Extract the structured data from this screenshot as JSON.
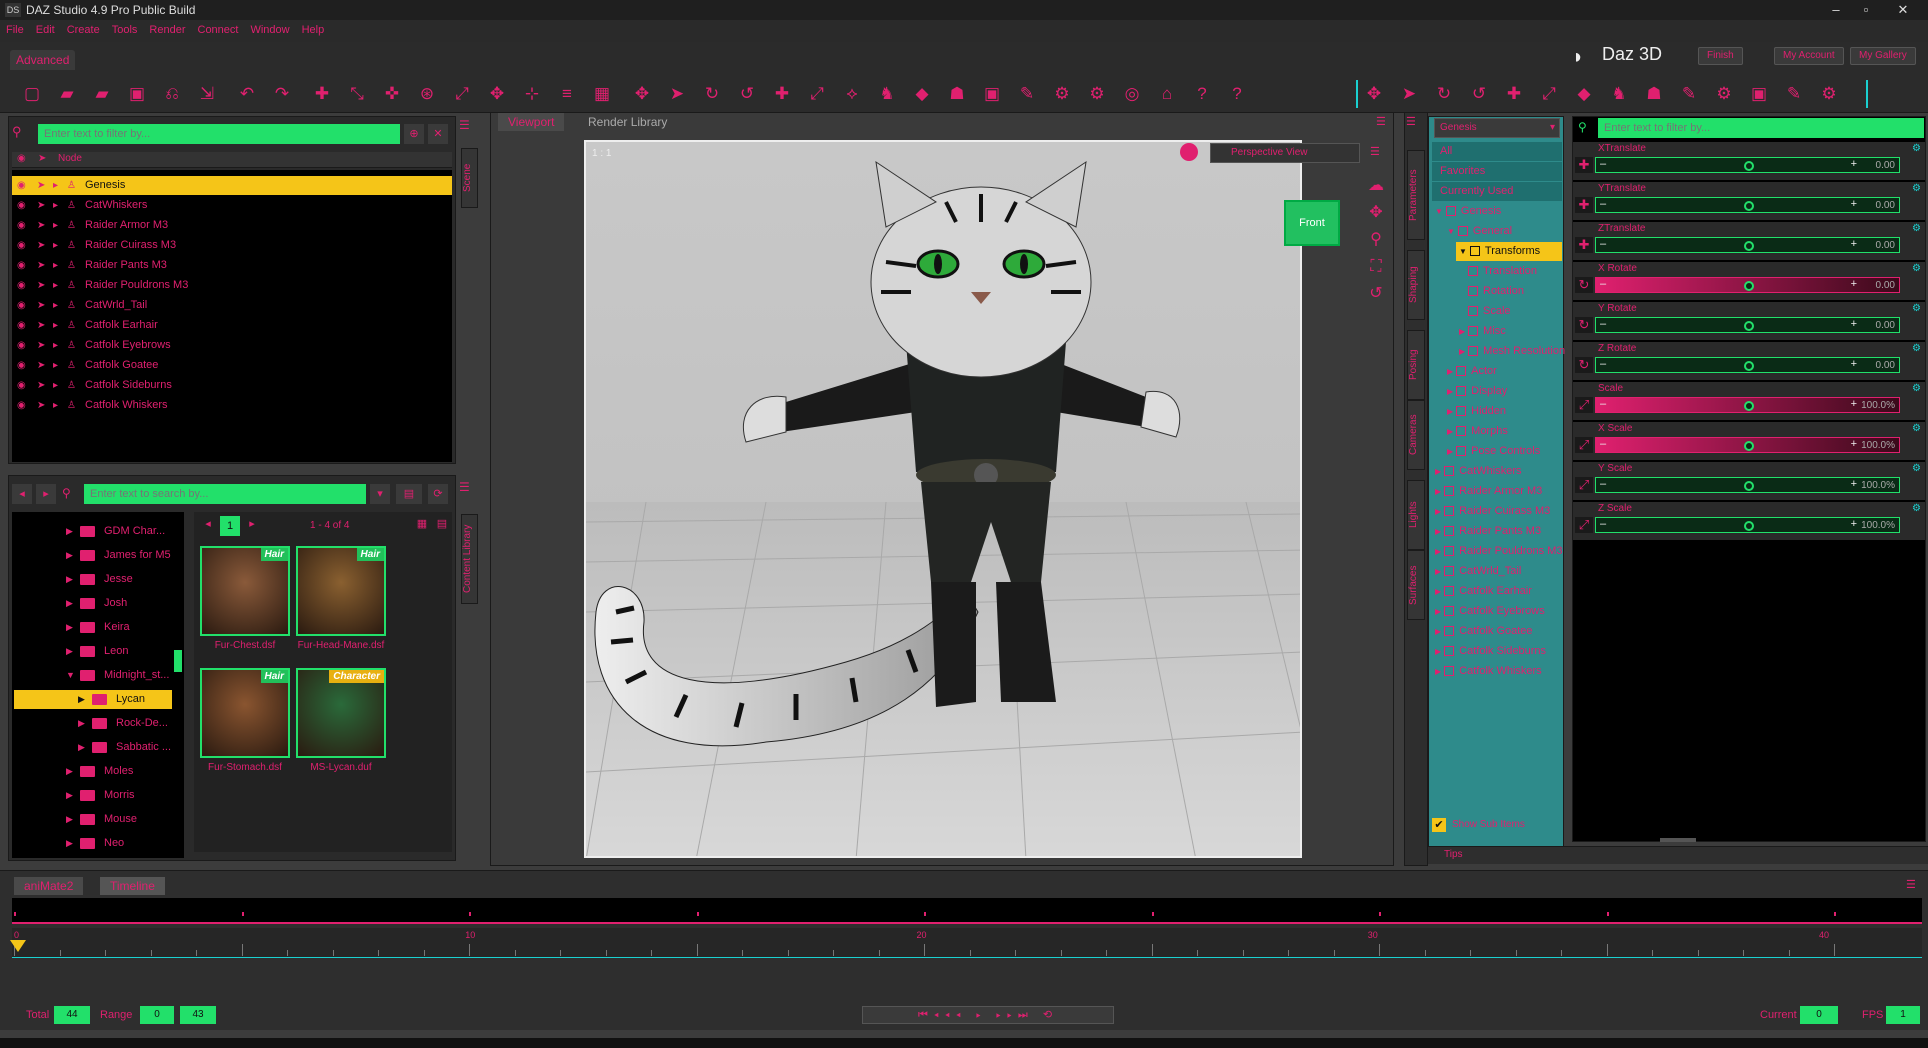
{
  "window": {
    "title": "DAZ Studio 4.9 Pro Public Build",
    "logo": "DS",
    "min": "–",
    "max": "▫",
    "close": "✕"
  },
  "menu": [
    "File",
    "Edit",
    "Create",
    "Tools",
    "Render",
    "Connect",
    "Window",
    "Help"
  ],
  "header": {
    "layout_tab": "Advanced",
    "brand": "Daz 3D",
    "buttons": [
      "Finish",
      "My Account",
      "My Gallery"
    ]
  },
  "scene": {
    "filter_placeholder": "Enter text to filter by...",
    "column_header": "Node",
    "nodes": [
      "Genesis",
      "CatWhiskers",
      "Raider Armor M3",
      "Raider Cuirass M3",
      "Raider Pants M3",
      "Raider Pouldrons M3",
      "CatWrld_Tail",
      "Catfolk Earhair",
      "Catfolk Eyebrows",
      "Catfolk Goatee",
      "Catfolk Sideburns",
      "Catfolk Whiskers"
    ],
    "selected": "Genesis",
    "side_tab": "Scene"
  },
  "content": {
    "search_placeholder": "Enter text to search by...",
    "side_tab": "Content Library",
    "folders": [
      {
        "label": "GDM Char...",
        "sub": false
      },
      {
        "label": "James for M5",
        "sub": false
      },
      {
        "label": "Jesse",
        "sub": false
      },
      {
        "label": "Josh",
        "sub": false
      },
      {
        "label": "Keira",
        "sub": false
      },
      {
        "label": "Leon",
        "sub": false
      },
      {
        "label": "Midnight_st...",
        "sub": false
      },
      {
        "label": "Lycan",
        "sub": true
      },
      {
        "label": "Rock-De...",
        "sub": true
      },
      {
        "label": "Sabbatic ...",
        "sub": true
      },
      {
        "label": "Moles",
        "sub": false
      },
      {
        "label": "Morris",
        "sub": false
      },
      {
        "label": "Mouse",
        "sub": false
      },
      {
        "label": "Neo",
        "sub": false
      }
    ],
    "selected_folder": "Lycan",
    "page": "1",
    "page_info": "1 - 4 of 4",
    "items": [
      {
        "caption": "Fur-Chest.dsf",
        "badge": "Hair"
      },
      {
        "caption": "Fur-Head-Mane.dsf",
        "badge": "Hair"
      },
      {
        "caption": "Fur-Stomach.dsf",
        "badge": "Hair"
      },
      {
        "caption": "MS-Lycan.duf",
        "badge": "Character"
      }
    ]
  },
  "viewport": {
    "tabs": [
      "Viewport",
      "Render Library"
    ],
    "corner_label": "1 : 1",
    "camera": "Perspective View",
    "cube_face": "Front"
  },
  "right_tabs": [
    "Parameters",
    "Shaping",
    "Posing",
    "Cameras",
    "Lights",
    "Surfaces"
  ],
  "params_tree": {
    "dropdown": "Genesis",
    "items": [
      {
        "label": "All",
        "indent": 0
      },
      {
        "label": "Favorites",
        "indent": 0
      },
      {
        "label": "Currently Used",
        "indent": 0
      },
      {
        "label": "Genesis",
        "indent": 0
      },
      {
        "label": "General",
        "indent": 1
      },
      {
        "label": "Transforms",
        "indent": 2
      },
      {
        "label": "Translation",
        "indent": 3
      },
      {
        "label": "Rotation",
        "indent": 3
      },
      {
        "label": "Scale",
        "indent": 3
      },
      {
        "label": "Misc",
        "indent": 2
      },
      {
        "label": "Mesh Resolution",
        "indent": 2
      },
      {
        "label": "Actor",
        "indent": 1
      },
      {
        "label": "Display",
        "indent": 1
      },
      {
        "label": "Hidden",
        "indent": 1
      },
      {
        "label": "Morphs",
        "indent": 1
      },
      {
        "label": "Pose Controls",
        "indent": 1
      },
      {
        "label": "CatWhiskers",
        "indent": 0
      },
      {
        "label": "Raider Armor M3",
        "indent": 0
      },
      {
        "label": "Raider Cuirass M3",
        "indent": 0
      },
      {
        "label": "Raider Pants M3",
        "indent": 0
      },
      {
        "label": "Raider Pouldrons M3",
        "indent": 0
      },
      {
        "label": "CatWrld_Tail",
        "indent": 0
      },
      {
        "label": "Catfolk Earhair",
        "indent": 0
      },
      {
        "label": "Catfolk Eyebrows",
        "indent": 0
      },
      {
        "label": "Catfolk Goatee",
        "indent": 0
      },
      {
        "label": "Catfolk Sideburns",
        "indent": 0
      },
      {
        "label": "Catfolk Whiskers",
        "indent": 0
      }
    ],
    "selected": "Transforms",
    "show_sub_items": "Show Sub Items",
    "tips": "Tips"
  },
  "params": {
    "filter_placeholder": "Enter text to filter by...",
    "list": [
      {
        "label": "XTranslate",
        "value": "0.00",
        "level": 0.5,
        "icon": "✚",
        "red": false
      },
      {
        "label": "YTranslate",
        "value": "0.00",
        "level": 0.5,
        "icon": "✚",
        "red": false
      },
      {
        "label": "ZTranslate",
        "value": "0.00",
        "level": 0.5,
        "icon": "✚",
        "red": false
      },
      {
        "label": "X Rotate",
        "value": "0.00",
        "level": 0.5,
        "icon": "↻",
        "red": true
      },
      {
        "label": "Y Rotate",
        "value": "0.00",
        "level": 0.5,
        "icon": "↻",
        "red": false
      },
      {
        "label": "Z Rotate",
        "value": "0.00",
        "level": 0.5,
        "icon": "↻",
        "red": false
      },
      {
        "label": "Scale",
        "value": "100.0%",
        "level": 0.5,
        "icon": "⤢",
        "red": true
      },
      {
        "label": "X Scale",
        "value": "100.0%",
        "level": 0.5,
        "icon": "⤢",
        "red": true
      },
      {
        "label": "Y Scale",
        "value": "100.0%",
        "level": 0.5,
        "icon": "⤢",
        "red": false
      },
      {
        "label": "Z Scale",
        "value": "100.0%",
        "level": 0.5,
        "icon": "⤢",
        "red": false
      }
    ]
  },
  "timeline": {
    "tabs": [
      "aniMate2",
      "Timeline"
    ],
    "ruler": [
      "0",
      "10",
      "20",
      "30",
      "40"
    ],
    "total_label": "Total",
    "total": "44",
    "range_label": "Range",
    "range_start": "0",
    "range_end": "43",
    "current_label": "Current",
    "current": "0",
    "fps_label": "FPS",
    "fps": "1"
  }
}
